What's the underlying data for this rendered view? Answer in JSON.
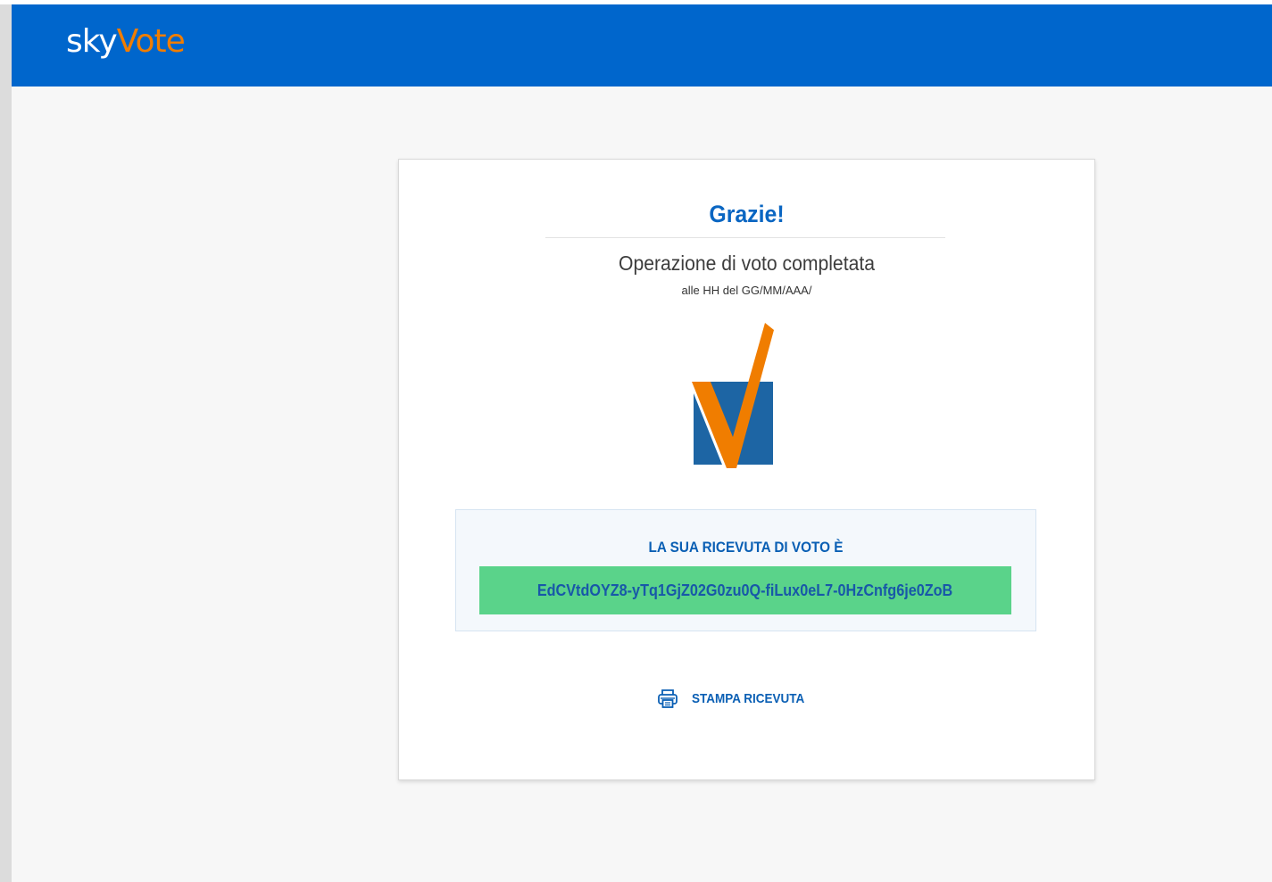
{
  "brand": {
    "logo_part1": "sky",
    "logo_part2": "Vote",
    "logo_color_primary": "#ffffff",
    "logo_color_accent": "#f07d00"
  },
  "colors": {
    "navbar": "#0066cc",
    "accent_blue": "#0a66c2",
    "accent_orange": "#f07d00",
    "receipt_green": "#5ad38a"
  },
  "card": {
    "title": "Grazie!",
    "subtitle": "Operazione di voto completata",
    "time": "alle HH del GG/MM/AAA/"
  },
  "receipt": {
    "label": "LA SUA RICEVUTA DI VOTO È",
    "code": "EdCVtdOYZ8-yTq1GjZ02G0zu0Q-fiLux0eL7-0HzCnfg6je0ZoB"
  },
  "actions": {
    "print_label": "STAMPA RICEVUTA",
    "print_icon": "printer-icon"
  }
}
